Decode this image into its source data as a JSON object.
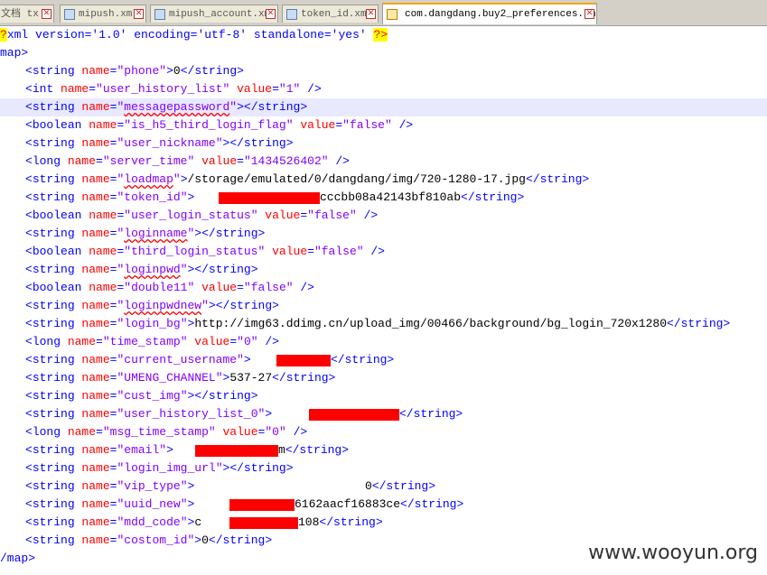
{
  "tabs": [
    {
      "label": "文档 tx",
      "active": false
    },
    {
      "label": "mipush.xml",
      "active": false
    },
    {
      "label": "mipush_account.xml",
      "active": false
    },
    {
      "label": "token_id.xml",
      "active": false
    },
    {
      "label": "com.dangdang.buy2_preferences.xml",
      "active": true
    }
  ],
  "xml": {
    "decl": {
      "start": "?",
      "body": "xml version='1.0' encoding='utf-8' standalone='yes' ",
      "end": "?>"
    },
    "root_open": "map>",
    "root_close": "/map>",
    "entries": [
      {
        "tag": "string",
        "name": "phone",
        "text": "0"
      },
      {
        "tag": "int",
        "name": "user_history_list",
        "value": "1"
      },
      {
        "tag": "string",
        "name": "messagepassword",
        "text": ""
      },
      {
        "tag": "boolean",
        "name": "is_h5_third_login_flag",
        "value": "false"
      },
      {
        "tag": "string",
        "name": "user_nickname",
        "text": ""
      },
      {
        "tag": "long",
        "name": "server_time",
        "value": "1434526402"
      },
      {
        "tag": "string",
        "name": "loadmap",
        "text": "/storage/emulated/0/dangdang/img/720-1280-17.jpg"
      },
      {
        "tag": "string",
        "name": "token_id",
        "text": "cccbb08a42143bf810ab",
        "redacted": true
      },
      {
        "tag": "boolean",
        "name": "user_login_status",
        "value": "false"
      },
      {
        "tag": "string",
        "name": "loginname",
        "text": ""
      },
      {
        "tag": "boolean",
        "name": "third_login_status",
        "value": "false"
      },
      {
        "tag": "string",
        "name": "loginpwd",
        "text": ""
      },
      {
        "tag": "boolean",
        "name": "double11",
        "value": "false"
      },
      {
        "tag": "string",
        "name": "loginpwdnew",
        "text": ""
      },
      {
        "tag": "string",
        "name": "login_bg",
        "text": "http://img63.ddimg.cn/upload_img/00466/background/bg_login_720x1280"
      },
      {
        "tag": "long",
        "name": "time_stamp",
        "value": "0"
      },
      {
        "tag": "string",
        "name": "current_username",
        "text": "",
        "redacted": true
      },
      {
        "tag": "string",
        "name": "UMENG_CHANNEL",
        "text": "537-27"
      },
      {
        "tag": "string",
        "name": "cust_img",
        "text": ""
      },
      {
        "tag": "string",
        "name": "user_history_list_0",
        "text": "",
        "redacted": true
      },
      {
        "tag": "long",
        "name": "msg_time_stamp",
        "value": "0"
      },
      {
        "tag": "string",
        "name": "email",
        "text": "m",
        "redacted": true
      },
      {
        "tag": "string",
        "name": "login_img_url",
        "text": ""
      },
      {
        "tag": "string",
        "name": "vip_type",
        "text": "0"
      },
      {
        "tag": "string",
        "name": "uuid_new",
        "text": "6162aacf16883ce",
        "redacted": true
      },
      {
        "tag": "string",
        "name": "mdd_code",
        "text": "108",
        "text_prefix": "c",
        "redacted": true
      },
      {
        "tag": "string",
        "name": "costom_id",
        "text": "0",
        "redacted": true
      }
    ]
  },
  "watermark": "www.wooyun.org",
  "colors": {
    "tag": "#0000ff",
    "attribute": "#ff0000",
    "value": "#8000ff",
    "text": "#000000",
    "redaction": "#ff0000",
    "current_line": "#e8e8ff"
  }
}
